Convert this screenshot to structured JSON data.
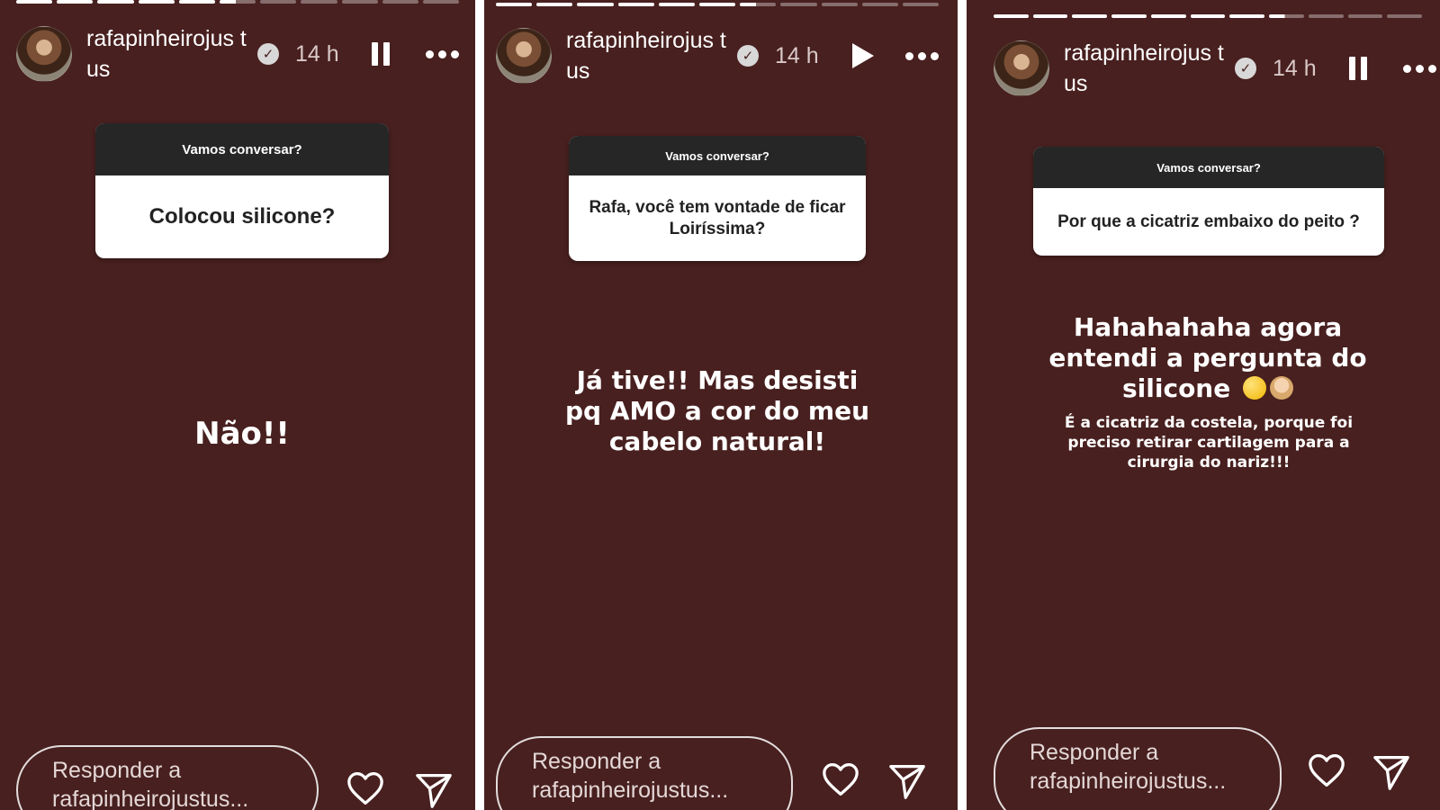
{
  "stories": [
    {
      "username": "rafapinheirojustus",
      "username_display": "rafapinheirojus tus",
      "time": "14 h",
      "playback_state": "pause",
      "question_header": "Vamos conversar?",
      "question": "Colocou silicone?",
      "answer": "Não!!",
      "reply_placeholder": "Responder a rafapinheirojustus..."
    },
    {
      "username": "rafapinheirojustus",
      "username_display": "rafapinheirojus tus",
      "time": "14 h",
      "playback_state": "play",
      "question_header": "Vamos conversar?",
      "question": "Rafa, você tem vontade de ficar Loiríssima?",
      "answer": "Já tive!! Mas desisti pq AMO a cor do meu cabelo natural!",
      "reply_placeholder": "Responder a rafapinheirojustus..."
    },
    {
      "username": "rafapinheirojustus",
      "username_display": "rafapinheirojus tus",
      "time": "14 h",
      "playback_state": "pause",
      "question_header": "Vamos conversar?",
      "question": "Por que a cicatriz embaixo do peito ?",
      "answer": "Hahahahaha agora entendi a pergunta do silicone",
      "answer_emojis": [
        "rolling-laughing-emoji",
        "facepalm-emoji"
      ],
      "sub_answer": "É a cicatriz da costela, porque foi preciso retirar cartilagem para a cirurgia do nariz!!!",
      "reply_placeholder": "Responder a rafapinheirojustus..."
    }
  ],
  "colors": {
    "story_background": "#48201f",
    "question_header_bg": "#262626",
    "card_bg": "#ffffff"
  },
  "icons": [
    "verified-badge-icon",
    "pause-icon",
    "play-icon",
    "more-options-icon",
    "heart-icon",
    "send-icon"
  ]
}
